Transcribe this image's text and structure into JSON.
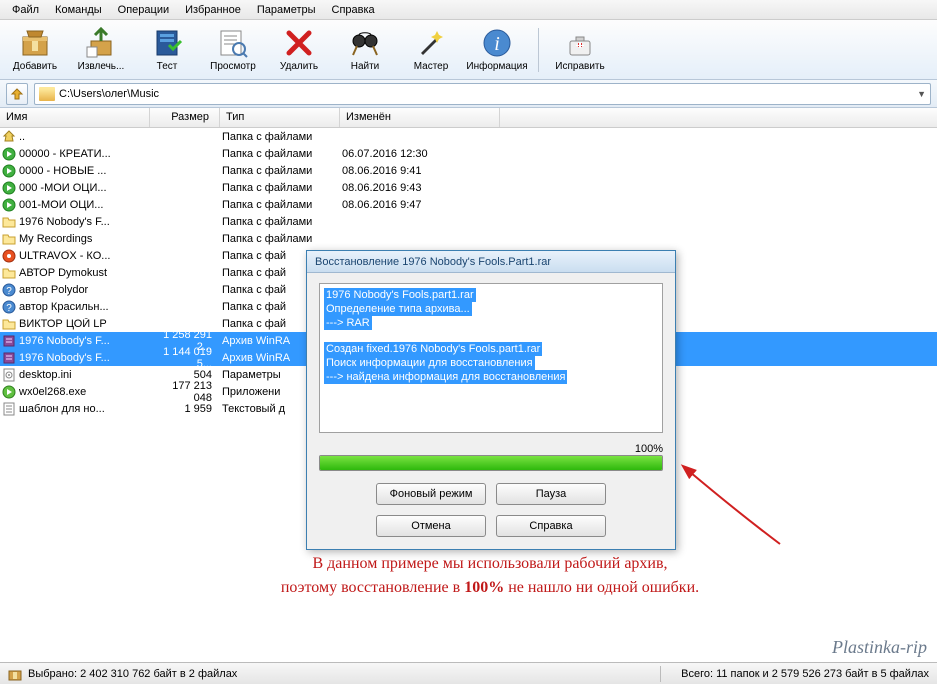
{
  "menu": [
    "Файл",
    "Команды",
    "Операции",
    "Избранное",
    "Параметры",
    "Справка"
  ],
  "toolbar": [
    {
      "label": "Добавить",
      "icon": "archive"
    },
    {
      "label": "Извлечь...",
      "icon": "extract"
    },
    {
      "label": "Тест",
      "icon": "test"
    },
    {
      "label": "Просмотр",
      "icon": "view"
    },
    {
      "label": "Удалить",
      "icon": "delete"
    },
    {
      "label": "Найти",
      "icon": "find"
    },
    {
      "label": "Мастер",
      "icon": "wizard"
    },
    {
      "label": "Информация",
      "icon": "info"
    },
    {
      "label": "Исправить",
      "icon": "repair"
    }
  ],
  "path": "C:\\Users\\олег\\Music",
  "columns": {
    "name": "Имя",
    "size": "Размер",
    "type": "Тип",
    "modified": "Изменён"
  },
  "files": [
    {
      "name": "..",
      "size": "",
      "type": "Папка с файлами",
      "mod": "",
      "icon": "up"
    },
    {
      "name": "00000 - КРЕАТИ...",
      "size": "",
      "type": "Папка с файлами",
      "mod": "06.07.2016 12:30",
      "icon": "play"
    },
    {
      "name": "0000 - НОВЫЕ ...",
      "size": "",
      "type": "Папка с файлами",
      "mod": "08.06.2016 9:41",
      "icon": "play"
    },
    {
      "name": "000 -МОИ ОЦИ...",
      "size": "",
      "type": "Папка с файлами",
      "mod": "08.06.2016 9:43",
      "icon": "play"
    },
    {
      "name": "001-МОИ ОЦИ...",
      "size": "",
      "type": "Папка с файлами",
      "mod": "08.06.2016 9:47",
      "icon": "play"
    },
    {
      "name": "1976 Nobody's F...",
      "size": "",
      "type": "Папка с файлами",
      "mod": "",
      "icon": "folder"
    },
    {
      "name": "My Recordings",
      "size": "",
      "type": "Папка с файлами",
      "mod": "",
      "icon": "folder"
    },
    {
      "name": "ULTRAVOX - КО...",
      "size": "",
      "type": "Папка с фай",
      "mod": "",
      "icon": "disc"
    },
    {
      "name": "АВТОР Dymokust",
      "size": "",
      "type": "Папка с фай",
      "mod": "",
      "icon": "folder"
    },
    {
      "name": "автор Polydor",
      "size": "",
      "type": "Папка с фай",
      "mod": "",
      "icon": "faq"
    },
    {
      "name": "автор Красильн...",
      "size": "",
      "type": "Папка с фай",
      "mod": "",
      "icon": "faq"
    },
    {
      "name": "ВИКТОР ЦОЙ LP",
      "size": "",
      "type": "Папка с фай",
      "mod": "",
      "icon": "folder"
    },
    {
      "name": "1976 Nobody's F...",
      "size": "1 258 291 2...",
      "type": "Архив WinRA",
      "mod": "",
      "icon": "rar",
      "sel": true
    },
    {
      "name": "1976 Nobody's F...",
      "size": "1 144 019 5...",
      "type": "Архив WinRA",
      "mod": "",
      "icon": "rar",
      "sel": true
    },
    {
      "name": "desktop.ini",
      "size": "504",
      "type": "Параметры ",
      "mod": "",
      "icon": "ini"
    },
    {
      "name": "wx0el268.exe",
      "size": "177 213 048",
      "type": "Приложени",
      "mod": "",
      "icon": "exe"
    },
    {
      "name": "шаблон для но...",
      "size": "1 959",
      "type": "Текстовый д",
      "mod": "",
      "icon": "txt"
    }
  ],
  "dialog": {
    "title": "Восстановление 1976 Nobody's Fools.Part1.rar",
    "log": [
      "1976 Nobody's Fools.part1.rar",
      "Определение типа архива...",
      "---> RAR",
      "",
      "Создан fixed.1976 Nobody's Fools.part1.rar",
      "Поиск информации для восстановления",
      "---> найдена информация для восстановления"
    ],
    "percent": "100%",
    "progress": 100,
    "buttons": {
      "bg": "Фоновый режим",
      "pause": "Пауза",
      "cancel": "Отмена",
      "help": "Справка"
    }
  },
  "caption": {
    "line1": "В данном примере мы использовали рабочий архив,",
    "line2a": "поэтому восстановление в ",
    "line2b": "100%",
    "line2c": " не нашло ни одной ошибки."
  },
  "status": {
    "left": "Выбрано: 2 402 310 762 байт в 2 файлах",
    "right": "Всего: 11 папок и 2 579 526 273 байт в 5 файлах"
  },
  "watermark": "Plastinka-rip"
}
